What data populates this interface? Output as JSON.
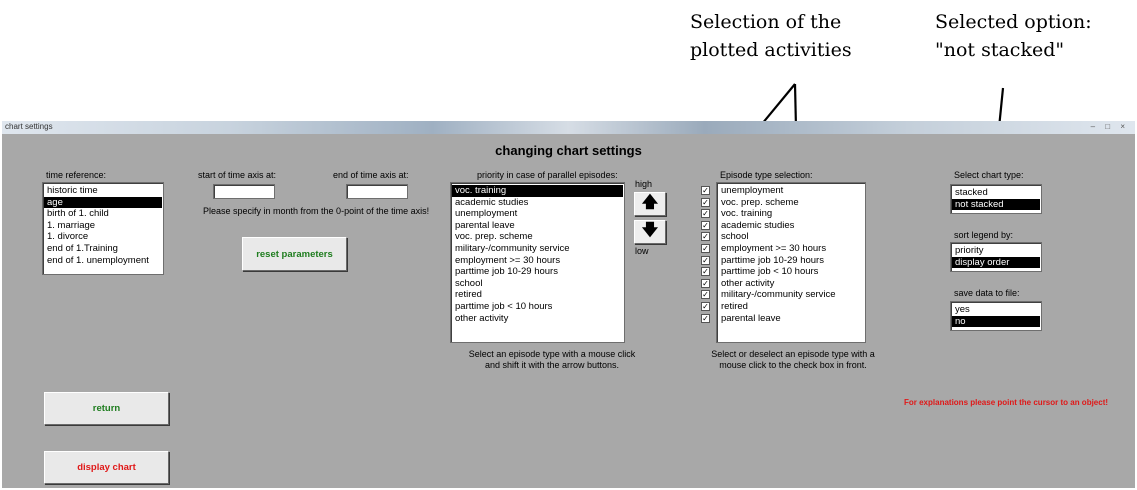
{
  "annotations": {
    "activities": "Selection of the plotted activities",
    "option": "Selected option: \"not stacked\""
  },
  "window": {
    "title": "chart settings",
    "heading": "changing chart settings"
  },
  "time_reference": {
    "label": "time reference:",
    "items": [
      "historic time",
      "age",
      "birth of 1. child",
      "1. marriage",
      "1. divorce",
      "end of 1.Training",
      "end of 1. unemployment"
    ],
    "selected": 1
  },
  "time_axis": {
    "start_label": "start of time axis at:",
    "end_label": "end of time axis at:",
    "start_value": "",
    "end_value": "",
    "note": "Please specify in month from the 0-point of the time axis!",
    "reset_label": "reset parameters"
  },
  "priority": {
    "label": "priority in case of parallel episodes:",
    "items": [
      "voc. training",
      "academic studies",
      "unemployment",
      "parental leave",
      "voc. prep. scheme",
      "military-/community service",
      "employment >= 30 hours",
      "parttime job 10-29 hours",
      "school",
      "retired",
      "parttime job < 10 hours",
      "other activity"
    ],
    "selected": 0,
    "high_label": "high",
    "low_label": "low",
    "up_icon": "arrow-up-icon",
    "down_icon": "arrow-down-icon",
    "up_glyph": "🡅",
    "down_glyph": "🡇",
    "help": "Select an episode type with a mouse click and shift it with the arrow buttons."
  },
  "episode_types": {
    "label": "Episode type selection:",
    "items": [
      "unemployment",
      "voc. prep. scheme",
      "voc. training",
      "academic studies",
      "school",
      "employment >= 30 hours",
      "parttime job 10-29 hours",
      "parttime job < 10 hours",
      "other activity",
      "military-/community service",
      "retired",
      "parental leave"
    ],
    "checked": [
      true,
      true,
      true,
      true,
      true,
      true,
      true,
      true,
      true,
      true,
      true,
      true
    ],
    "check_glyph": "✓",
    "help": "Select or deselect an episode type with a mouse click to the check box in front."
  },
  "chart_type": {
    "label": "Select chart type:",
    "items": [
      "stacked",
      "not stacked"
    ],
    "selected": 1
  },
  "sort_legend": {
    "label": "sort legend by:",
    "items": [
      "priority",
      "display order"
    ],
    "selected": 1
  },
  "save_data": {
    "label": "save data to file:",
    "items": [
      "yes",
      "no"
    ],
    "selected": 1
  },
  "buttons": {
    "return_label": "return",
    "display_label": "display chart"
  },
  "hint": "For explanations please point the cursor to an object!",
  "colors": {
    "window_bg": "#a8a8a8",
    "green_text": "#1f7d1f",
    "red_text": "#e01818"
  }
}
